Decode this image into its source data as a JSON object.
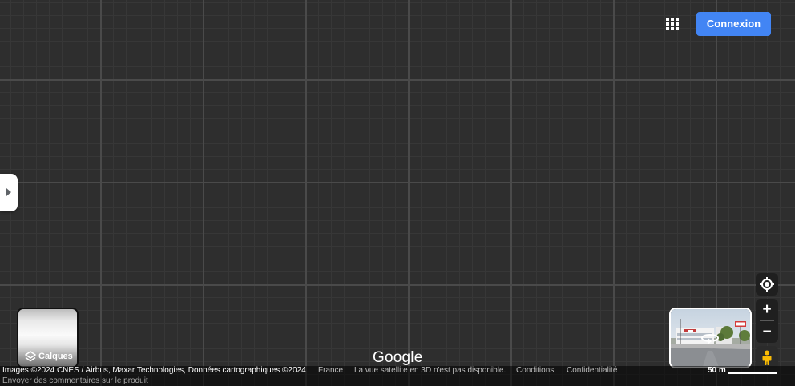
{
  "colors": {
    "accent": "#4285f4",
    "map_background": "#2e2e2e",
    "control_background": "#1f1f1f",
    "pegman": "#fbbc04"
  },
  "top_bar": {
    "apps_icon": "apps-grid-icon",
    "signin_label": "Connexion"
  },
  "side_panel": {
    "toggle_icon": "chevron-right-icon"
  },
  "layers": {
    "icon": "layers-icon",
    "label": "Calques"
  },
  "street_view_preview": {
    "icon": "rotate-360-icon"
  },
  "map_controls": {
    "my_location_icon": "my-location-icon",
    "zoom_in_label": "+",
    "zoom_out_label": "−",
    "pegman_icon": "pegman-icon"
  },
  "logo": {
    "text": "Google"
  },
  "footer": {
    "attribution": "Images ©2024 CNES / Airbus, Maxar Technologies, Données cartographiques ©2024",
    "country": "France",
    "notice": "La vue satellite en 3D n'est pas disponible.",
    "terms": "Conditions",
    "privacy": "Confidentialité",
    "scale_label": "50 m",
    "feedback": "Envoyer des commentaires sur le produit"
  }
}
